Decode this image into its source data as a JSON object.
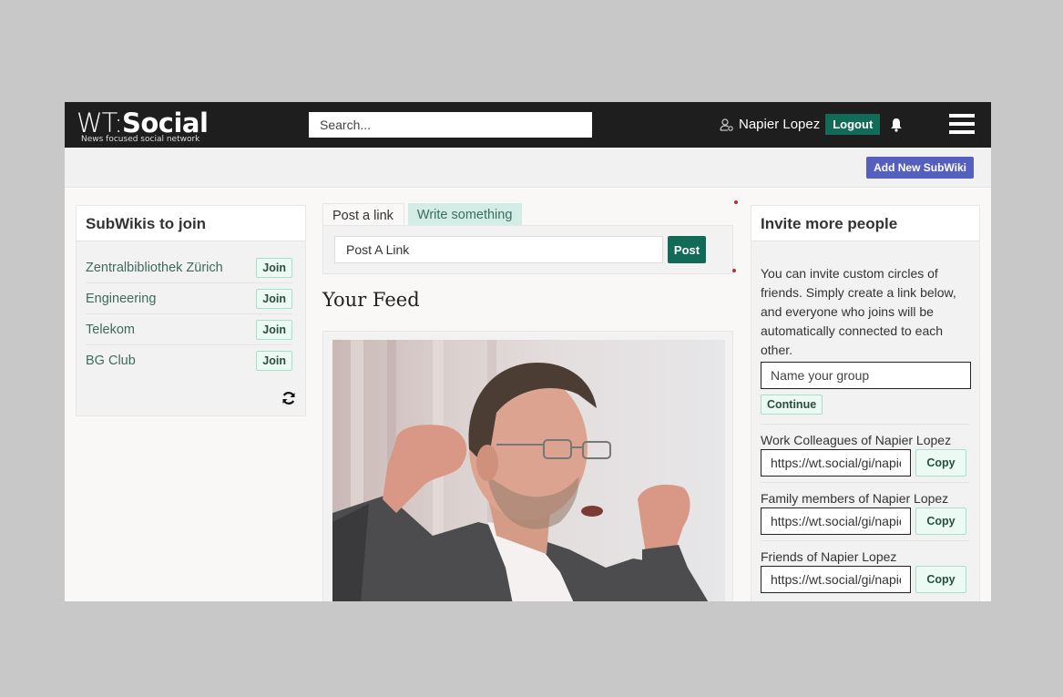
{
  "header": {
    "logo_wt": "WT:",
    "logo_social": "Social",
    "tagline": "News focused social network",
    "search_placeholder": "Search...",
    "user_name": "Napier Lopez",
    "logout_label": "Logout",
    "icons": {
      "user": "user-cog-icon",
      "bell": "bell-icon",
      "menu": "hamburger-menu-icon"
    }
  },
  "subbar": {
    "add_subwiki_label": "Add New SubWiki"
  },
  "colors": {
    "brand_green": "#126b57",
    "accent_blue": "#5560be",
    "join_bg": "#ecfaf4",
    "tab_inactive_bg": "#d3ece5",
    "topbar": "#1e1e1e"
  },
  "subwikis": {
    "title": "SubWikis to join",
    "items": [
      {
        "name": "Zentralbibliothek Zürich",
        "action": "Join"
      },
      {
        "name": "Engineering",
        "action": "Join"
      },
      {
        "name": "Telekom",
        "action": "Join"
      },
      {
        "name": "BG Club",
        "action": "Join"
      }
    ],
    "refresh_icon": "refresh-icon"
  },
  "composer": {
    "tabs": [
      {
        "label": "Post a link",
        "active": true
      },
      {
        "label": "Write something",
        "active": false
      }
    ],
    "input_placeholder": "Post A Link",
    "post_label": "Post"
  },
  "feed": {
    "title": "Your Feed",
    "image_alt": "Photo of a man with glasses raising his fists"
  },
  "invite": {
    "title": "Invite more people",
    "description": "You can invite custom circles of friends. Simply create a link below, and everyone who joins will be automatically connected to each other.",
    "group_placeholder": "Name your group",
    "continue_label": "Continue",
    "links": [
      {
        "label": "Work Colleagues of Napier Lopez",
        "url": "https://wt.social/gi/napier-lopez",
        "copy_label": "Copy"
      },
      {
        "label": "Family members of Napier Lopez",
        "url": "https://wt.social/gi/napier-lopez",
        "copy_label": "Copy"
      },
      {
        "label": "Friends of Napier Lopez",
        "url": "https://wt.social/gi/napier-lopez",
        "copy_label": "Copy"
      }
    ]
  }
}
